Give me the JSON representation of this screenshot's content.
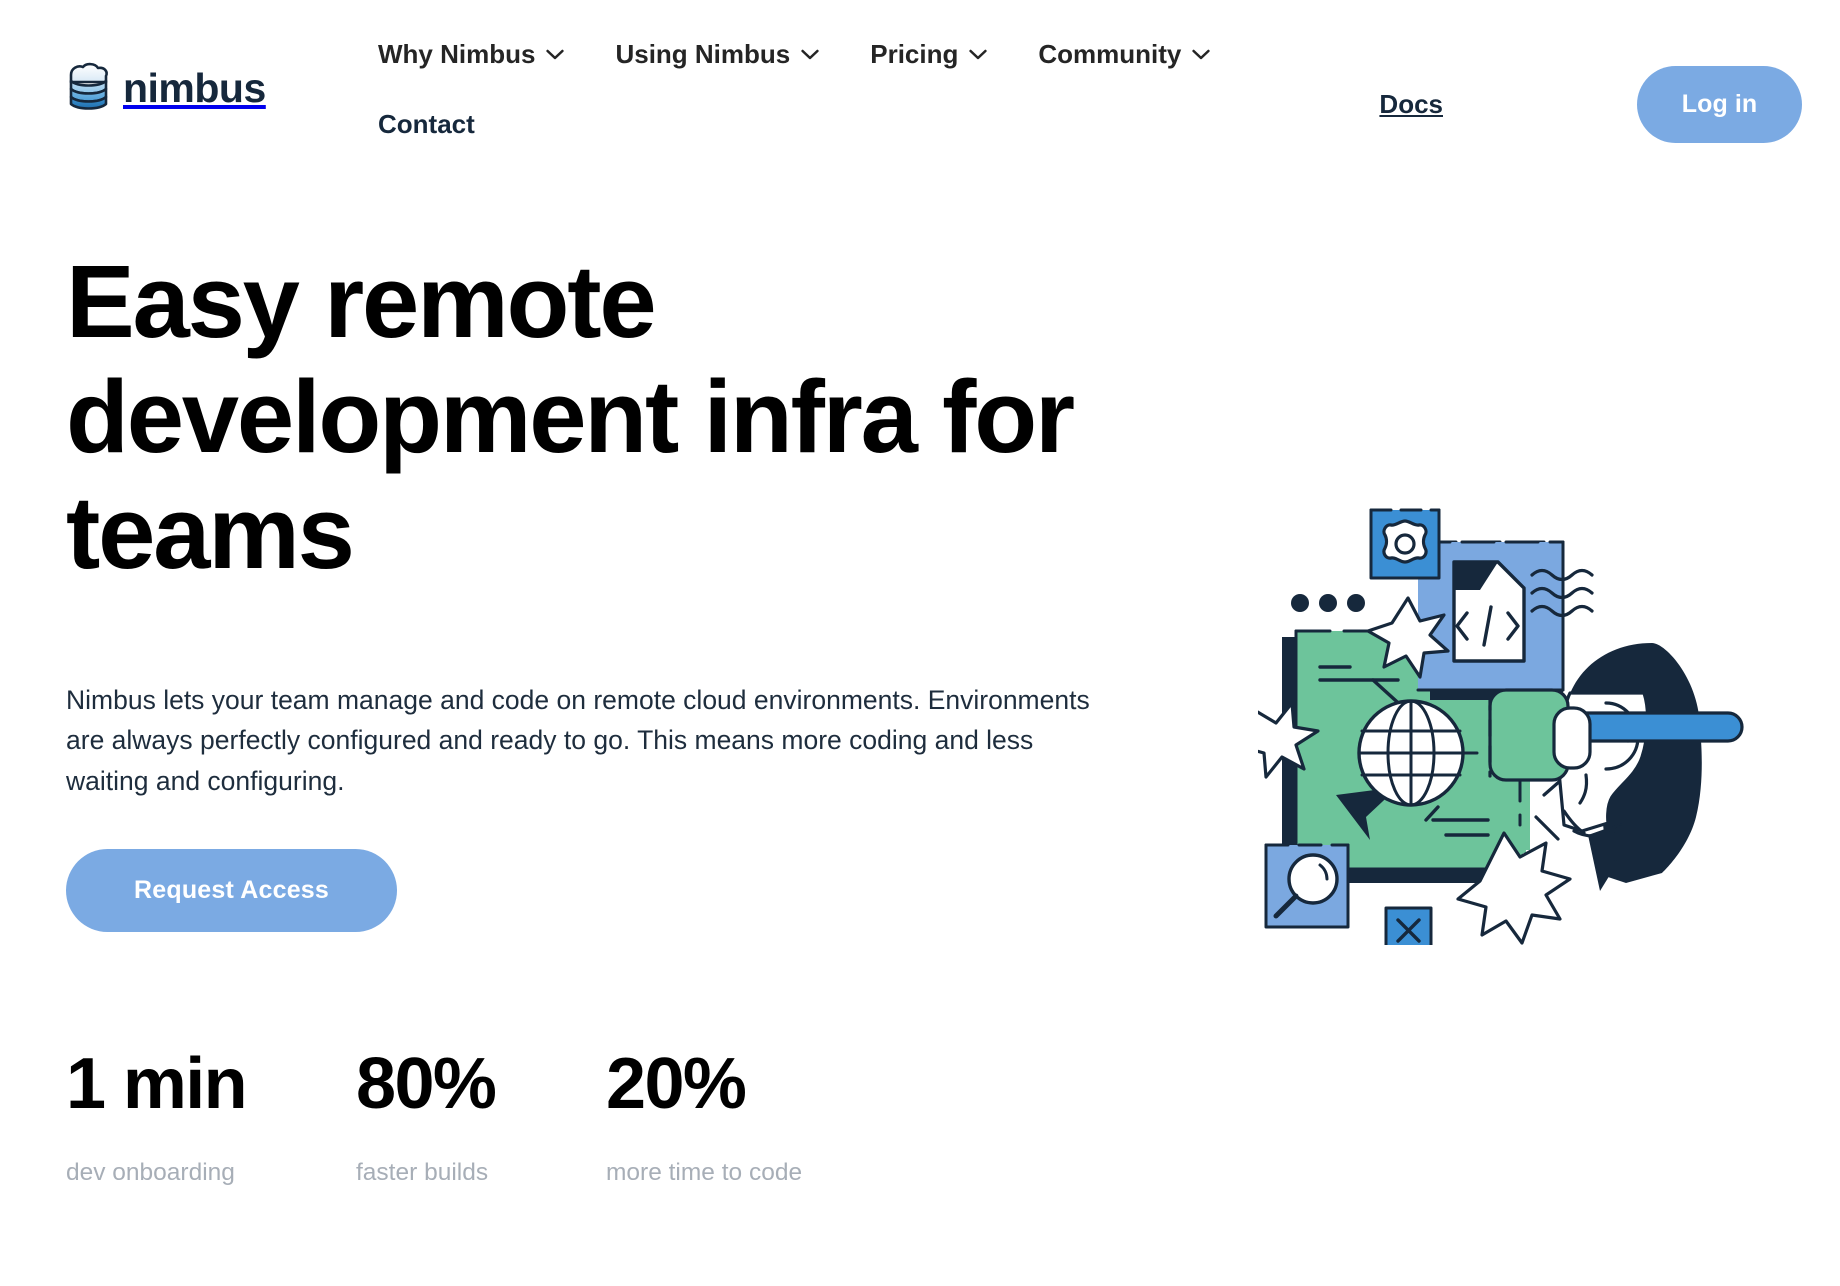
{
  "brand": {
    "name": "nimbus",
    "logo_icon": "stacked-cloud-database-icon"
  },
  "nav": {
    "items": [
      {
        "label": "Why Nimbus",
        "has_dropdown": true,
        "icon": "chevron-down-icon"
      },
      {
        "label": "Using Nimbus",
        "has_dropdown": true,
        "icon": "chevron-down-icon"
      },
      {
        "label": "Pricing",
        "has_dropdown": true,
        "icon": "chevron-down-icon"
      },
      {
        "label": "Community",
        "has_dropdown": true,
        "icon": "chevron-down-icon"
      },
      {
        "label": "Contact",
        "has_dropdown": false,
        "icon": ""
      }
    ],
    "docs_label": "Docs",
    "login_label": "Log in"
  },
  "hero": {
    "headline": "Easy remote development infra for teams",
    "subcopy": "Nimbus lets your team manage and code on remote cloud environments. Environments are always perfectly configured and ready to go. This means more coding and less waiting and configuring.",
    "cta_label": "Request Access",
    "illustration_name": "remote-dev-vr-illustration"
  },
  "stats": [
    {
      "value": "1 min",
      "label": "dev onboarding"
    },
    {
      "value": "80%",
      "label": "faster builds"
    },
    {
      "value": "20%",
      "label": "more time to code"
    }
  ],
  "colors": {
    "accent_blue": "#7BAAE3",
    "deep_blue": "#3B8FD4",
    "navy": "#16283C",
    "green": "#6DC49B",
    "text_black": "#000000",
    "muted_gray": "#A7AEB7",
    "background": "#FFFFFF"
  }
}
